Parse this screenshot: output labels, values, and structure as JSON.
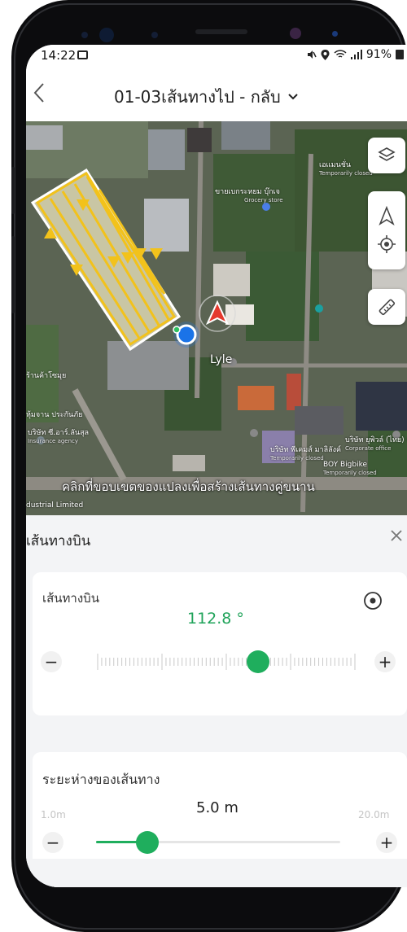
{
  "status_bar": {
    "time": "14:22",
    "battery": "91%"
  },
  "header": {
    "title": "01-03เส้นทางไป - กลับ"
  },
  "map": {
    "drone_name": "Lyle",
    "hint": "คลิกที่ขอบเขตของแปลงเพื่อสร้างเส้นทางคู่ขนาน",
    "labels": {
      "shop1": "เอเเมนชั่น",
      "shop1_sub": "Temporarily closed",
      "shop2": "ขายเบกระหยม บุ๊กเจ",
      "shop2_sub": "Grocery store",
      "left1": "ร้านค้าโซมุย",
      "left2": "หุ้มจาน ประกันภัย",
      "left3": "บริษัท ซี.อาร์.ลันสุล",
      "left3_sub": "Insurance agency",
      "company1": "บริษัท พีเคมส์ มาลิลังค์",
      "company1_sub": "Temporarily closed",
      "company2": "BOY Bigbike",
      "company2_sub": "Temporarily closed",
      "company3": "บริษัท ยุพิวล์ (ไทย) จำกัด",
      "company3_sub": "Corporate office",
      "bottom_left": "dustrial Limited"
    }
  },
  "panel": {
    "title": "เส้นทางบิน",
    "direction": {
      "label": "เส้นทางบิน",
      "value": "112.8 °",
      "slider_fraction": 0.62,
      "minus": "−",
      "plus": "+"
    },
    "spacing": {
      "label": "ระยะห่างของเส้นทาง",
      "value": "5.0 m",
      "min": "1.0m",
      "max": "20.0m",
      "slider_fraction": 0.21,
      "minus": "−",
      "plus": "+"
    }
  },
  "colors": {
    "accent_green": "#1fae5d",
    "value_green": "#20a35a",
    "route_yellow": "#f2c21b",
    "drone_red": "#e5392d",
    "location_blue": "#1a73e8"
  }
}
